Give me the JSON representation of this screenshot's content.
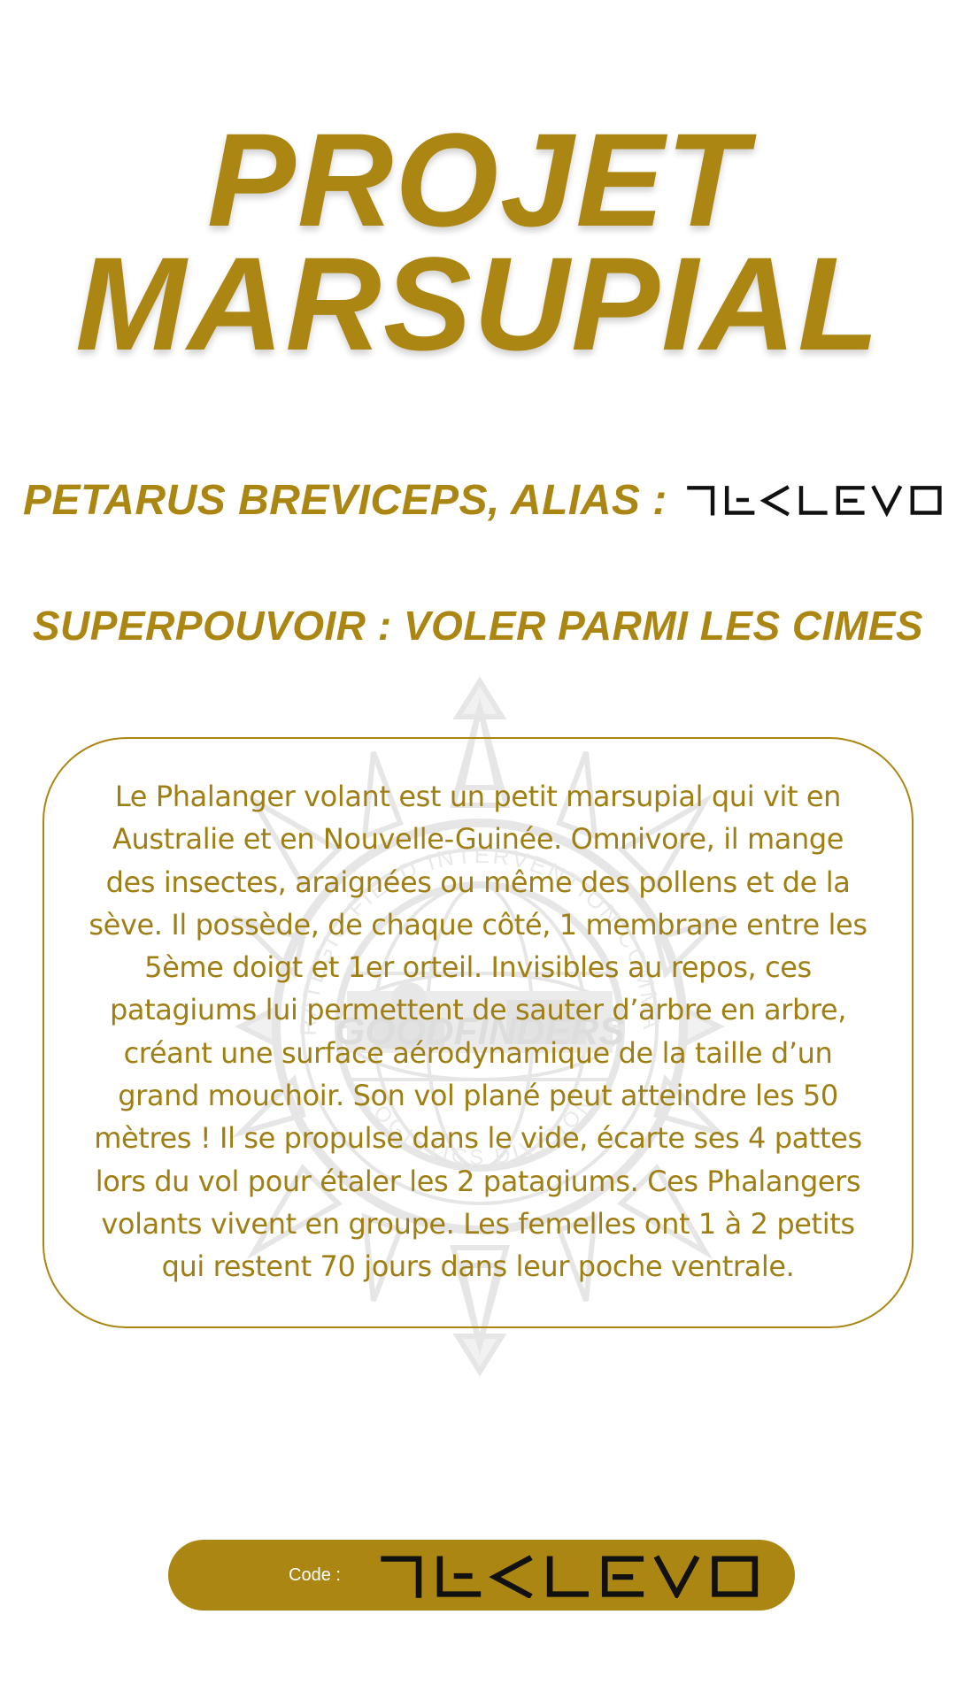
{
  "title": {
    "line1": "Projet",
    "line2": "Marsupial"
  },
  "alias": {
    "label": "Petarus breviceps, alias :"
  },
  "power": {
    "label": "Superpouvoir : voler parmi les cimes"
  },
  "description": {
    "text": "Le Phalanger volant est un petit marsupial qui vit en Australie et en Nouvelle-Guinée. Omnivore, il mange des insectes, araignées ou même des pollens et de la sève. Il possède, de chaque côté, 1 membrane entre les 5ème doigt et 1er orteil. Invisibles au repos, ces patagiums lui permettent de sauter d’arbre en arbre, créant une surface aérodynamique de la taille d’un grand mouchoir. Son vol plané peut atteindre les 50 mètres ! Il se propulse dans le vide, écarte ses 4 pattes lors du vol pour étaler les 2 patagiums. Ces Phalangers volants vivent en groupe. Les femelles ont 1 à 2 petits qui restent 70 jours dans leur poche ventrale."
  },
  "watermark": {
    "ring_text": "STRATEGIC FIELD INTERVENTION COMMAND",
    "bottom_text": "LOGISTICS DIVISION",
    "center_text": "GOODFINDERS"
  },
  "code_bar": {
    "label": "Code :"
  },
  "icons": {
    "alias_code": "cipher-code-glyphs",
    "bar_code": "cipher-code-glyphs",
    "watermark": "emblem-watermark"
  },
  "colors": {
    "accent": "#ab8612",
    "text": "#9f7f14",
    "background": "#ffffff",
    "glyph": "#111111"
  }
}
